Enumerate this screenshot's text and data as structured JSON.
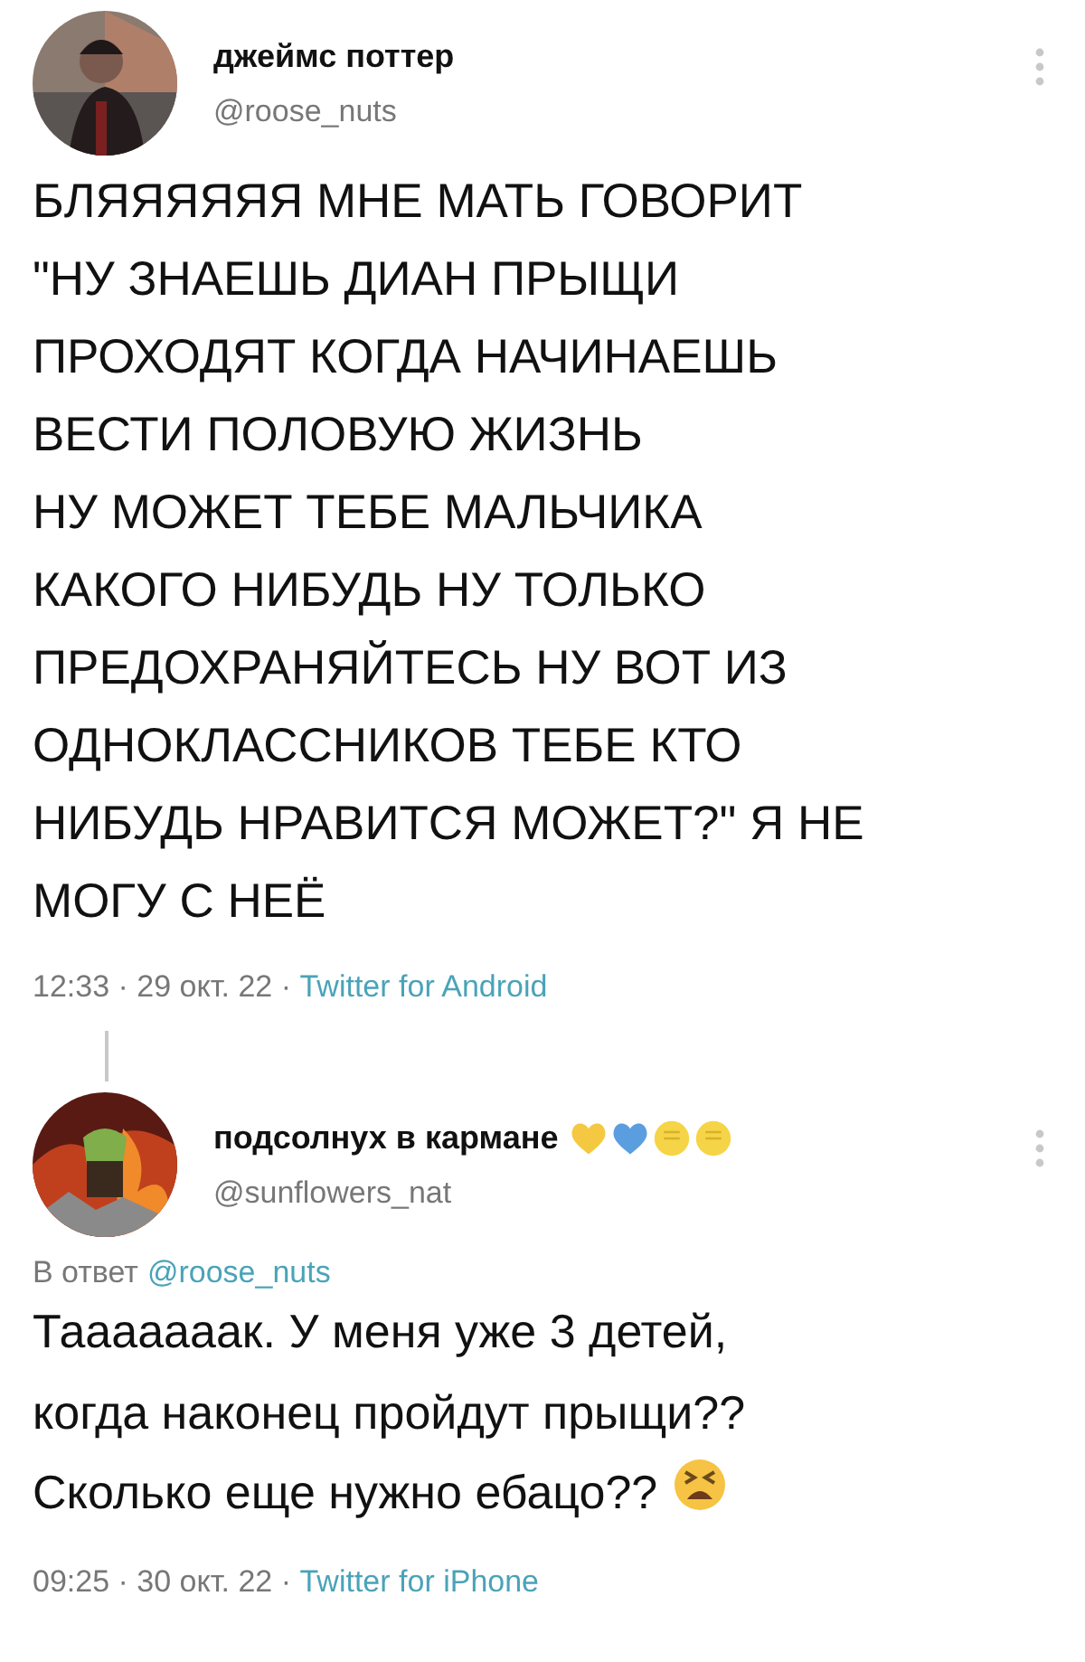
{
  "tweets": [
    {
      "name": "джеймс поттер",
      "handle": "@roose_nuts",
      "text": "БЛЯЯЯЯЯЯ МНЕ МАТЬ ГОВОРИТ\n\"НУ ЗНАЕШЬ ДИАН ПРЫЩИ\nПРОХОДЯТ КОГДА НАЧИНАЕШЬ\nВЕСТИ ПОЛОВУЮ ЖИЗНЬ\nНУ МОЖЕТ ТЕБЕ МАЛЬЧИКА\nКАКОГО НИБУДЬ НУ ТОЛЬКО\nПРЕДОХРАНЯЙТЕСЬ НУ ВОТ ИЗ\nОДНОКЛАССНИКОВ ТЕБЕ КТО\nНИБУДЬ НРАВИТСЯ МОЖЕТ?\" Я НЕ\nМОГУ С НЕЁ",
      "time": "12:33 · 29 окт. 22 · ",
      "source": "Twitter for Android",
      "thread_line": true
    },
    {
      "name": "подсолнух в кармане",
      "handle": "@sunflowers_nat",
      "reply_label": "В ответ",
      "reply_to": "@roose_nuts",
      "name_emoji": [
        {
          "kind": "heart",
          "color": "#f5c842"
        },
        {
          "kind": "heart",
          "color": "#5b9ee0"
        },
        {
          "kind": "fist",
          "color": "#f5d547"
        },
        {
          "kind": "fist",
          "color": "#f5d547"
        }
      ],
      "text": "Тааааааак. У меня уже 3 детей,\nкогда наконец пройдут прыщи??\nСколько еще нужно ебацо??",
      "text_emoji": {
        "kind": "tired"
      },
      "time": "09:25 · 30 окт. 22 · ",
      "source": "Twitter for iPhone",
      "thread_line": false
    }
  ]
}
